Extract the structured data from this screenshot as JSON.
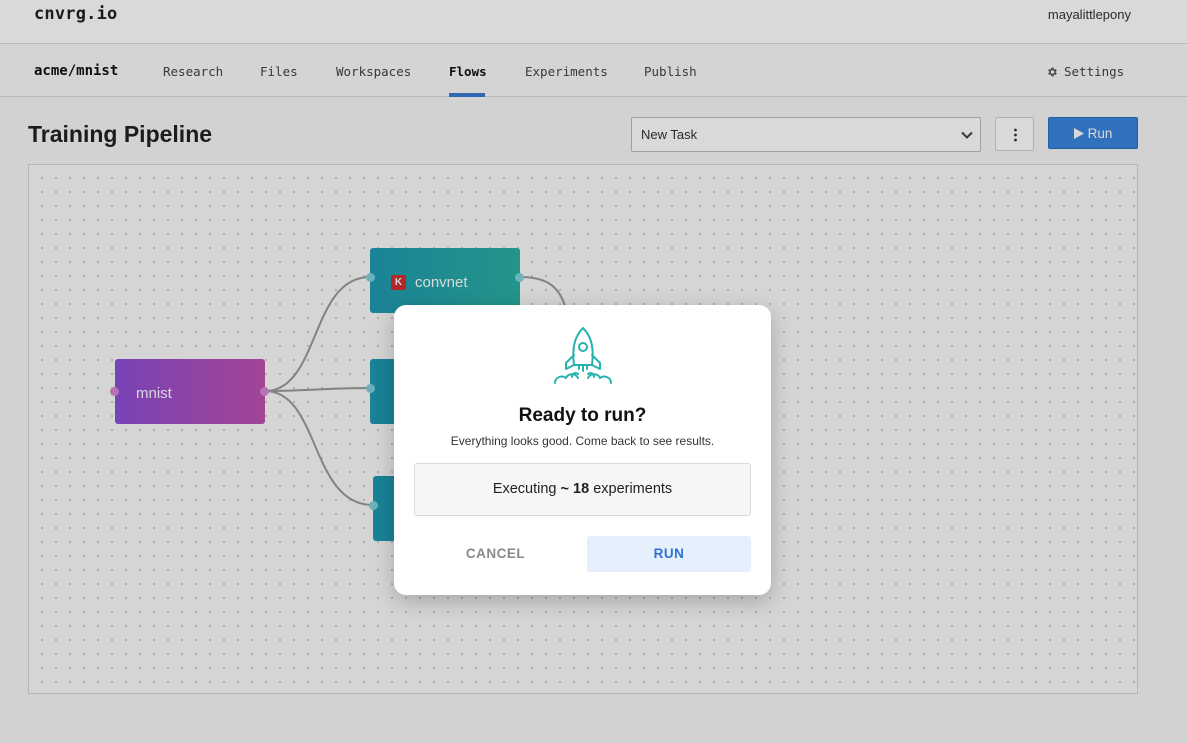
{
  "app": {
    "brand": "cnvrg.io",
    "user": "mayalittlepony"
  },
  "project": {
    "name": "acme/mnist",
    "tabs": [
      {
        "label": "Research"
      },
      {
        "label": "Files"
      },
      {
        "label": "Workspaces"
      },
      {
        "label": "Flows",
        "active": true
      },
      {
        "label": "Experiments"
      },
      {
        "label": "Publish"
      }
    ],
    "settings_label": "Settings"
  },
  "toolbar": {
    "title": "Training Pipeline",
    "task_select": {
      "value": "New Task"
    },
    "run_label": "Run"
  },
  "flow": {
    "nodes": [
      {
        "label": "mnist"
      },
      {
        "label": "convnet",
        "badge": "K"
      },
      {
        "label": ""
      },
      {
        "label": ""
      }
    ]
  },
  "modal": {
    "title": "Ready to run?",
    "subtitle": "Everything looks good. Come back to see results.",
    "exec_prefix": "Executing",
    "exec_count": "~ 18",
    "exec_suffix": "experiments",
    "cancel_label": "CANCEL",
    "run_label": "RUN"
  },
  "colors": {
    "accent": "#3a87e0",
    "tab_underline": "#3a7bd5",
    "node_data_start": "#8e4fd6",
    "node_data_end": "#c050b0",
    "node_task": "#1f9bb2",
    "rocket": "#26b3b0",
    "modal_run_text": "#2f73d0"
  }
}
